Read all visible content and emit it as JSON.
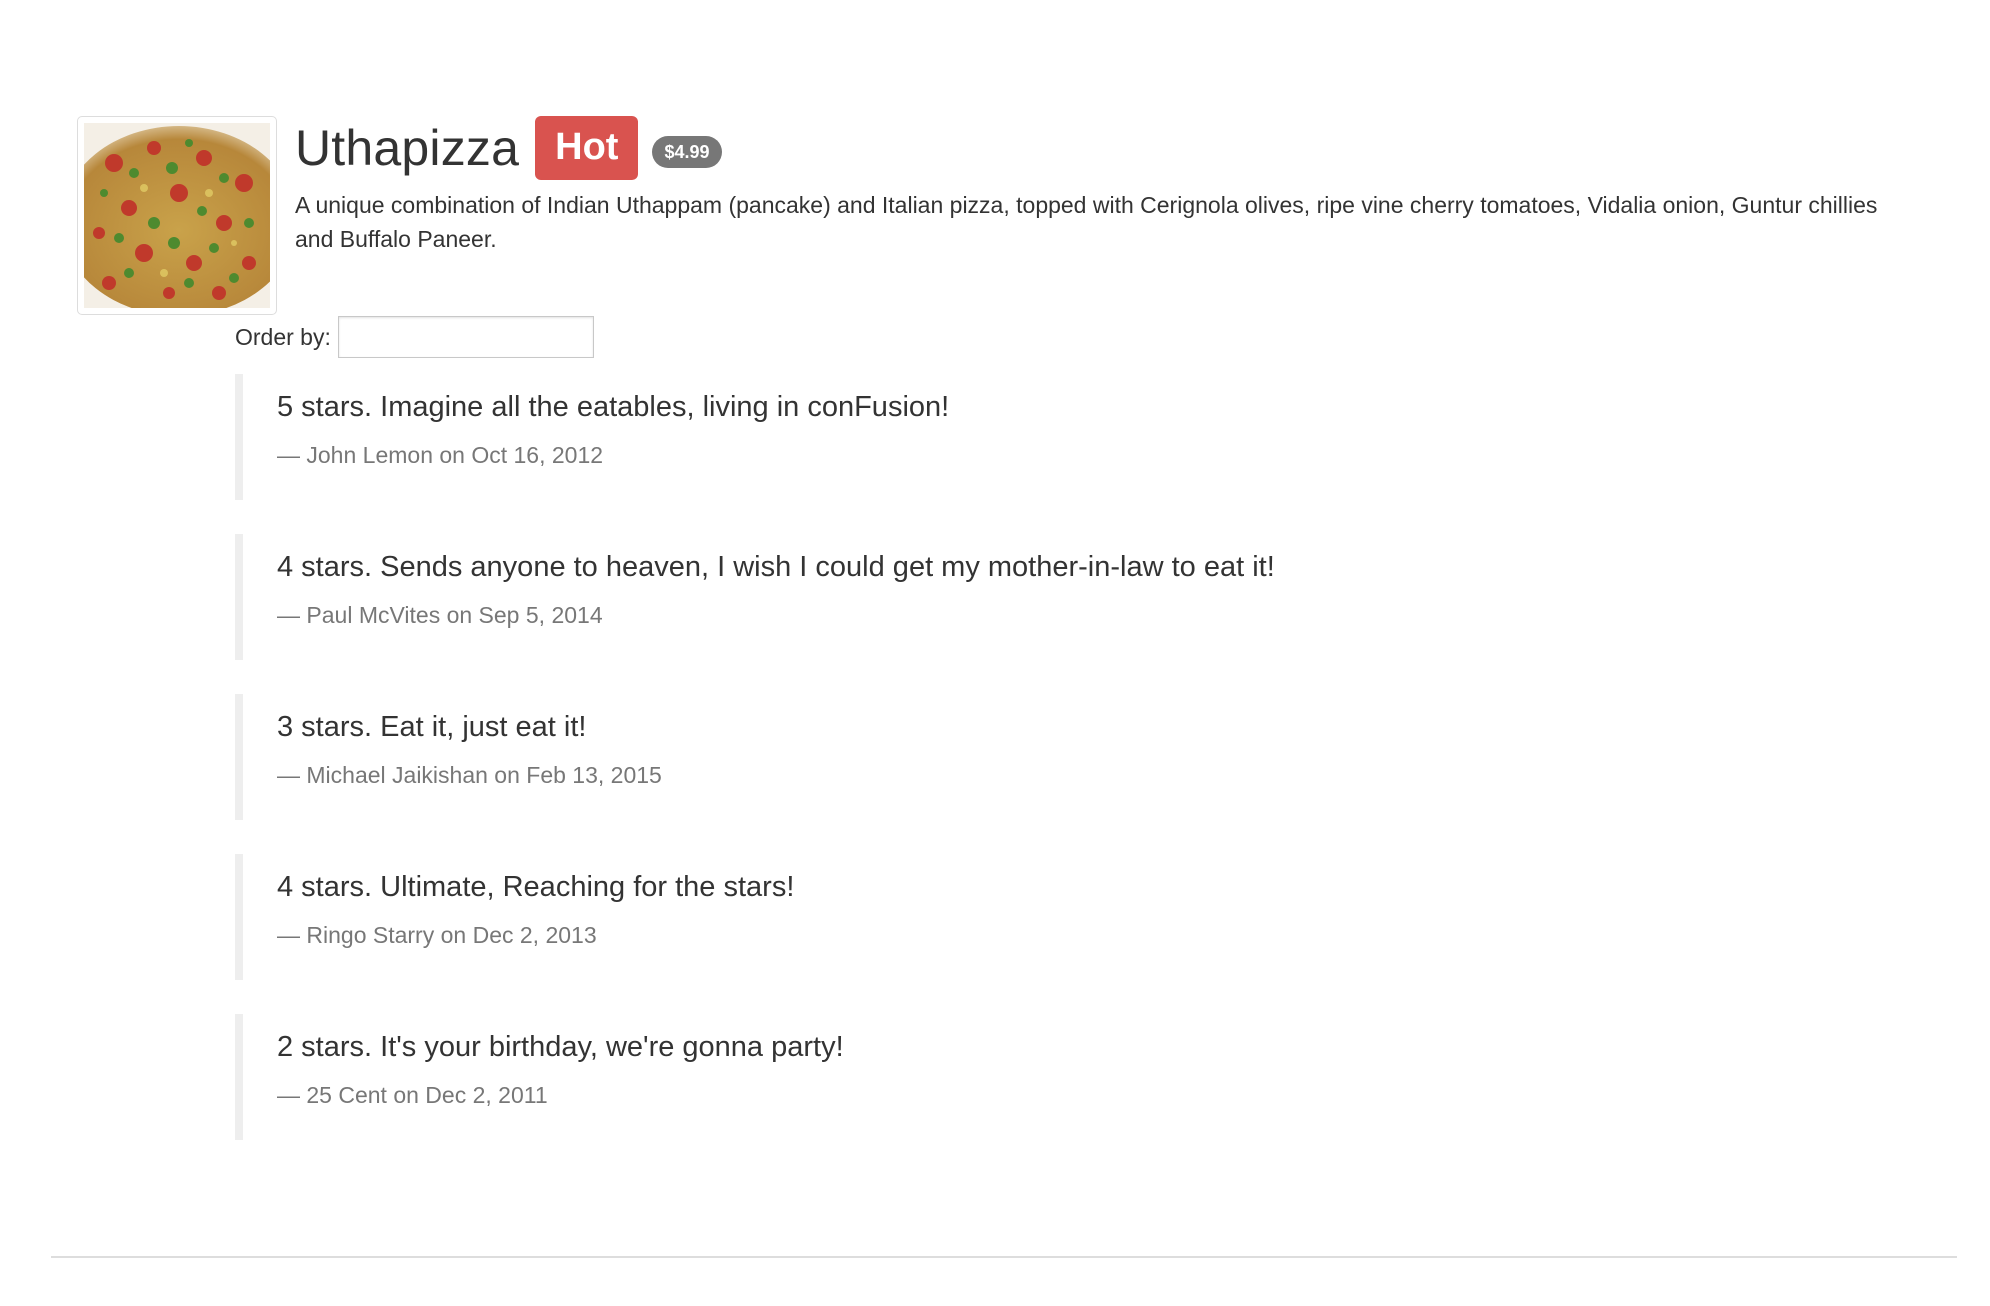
{
  "dish": {
    "name": "Uthapizza",
    "label": "Hot",
    "price": "$4.99",
    "description": "A unique combination of Indian Uthappam (pancake) and Italian pizza, topped with Cerignola olives, ripe vine cherry tomatoes, Vidalia onion, Guntur chillies and Buffalo Paneer.",
    "image_alt": "Uthapizza"
  },
  "order": {
    "label": "Order by:",
    "value": "",
    "placeholder": ""
  },
  "comments": [
    {
      "text": "5 stars. Imagine all the eatables, living in conFusion!",
      "footer": "— John Lemon on Oct 16, 2012"
    },
    {
      "text": "4 stars. Sends anyone to heaven, I wish I could get my mother-in-law to eat it!",
      "footer": "— Paul McVites on Sep 5, 2014"
    },
    {
      "text": "3 stars. Eat it, just eat it!",
      "footer": "— Michael Jaikishan on Feb 13, 2015"
    },
    {
      "text": "4 stars. Ultimate, Reaching for the stars!",
      "footer": "— Ringo Starry on Dec 2, 2013"
    },
    {
      "text": "2 stars. It's your birthday, we're gonna party!",
      "footer": "— 25 Cent on Dec 2, 2011"
    }
  ],
  "colors": {
    "hot_label": "#d9534f",
    "price_badge": "#777777",
    "text": "#333333",
    "muted": "#777777",
    "quote_border": "#eeeeee"
  }
}
